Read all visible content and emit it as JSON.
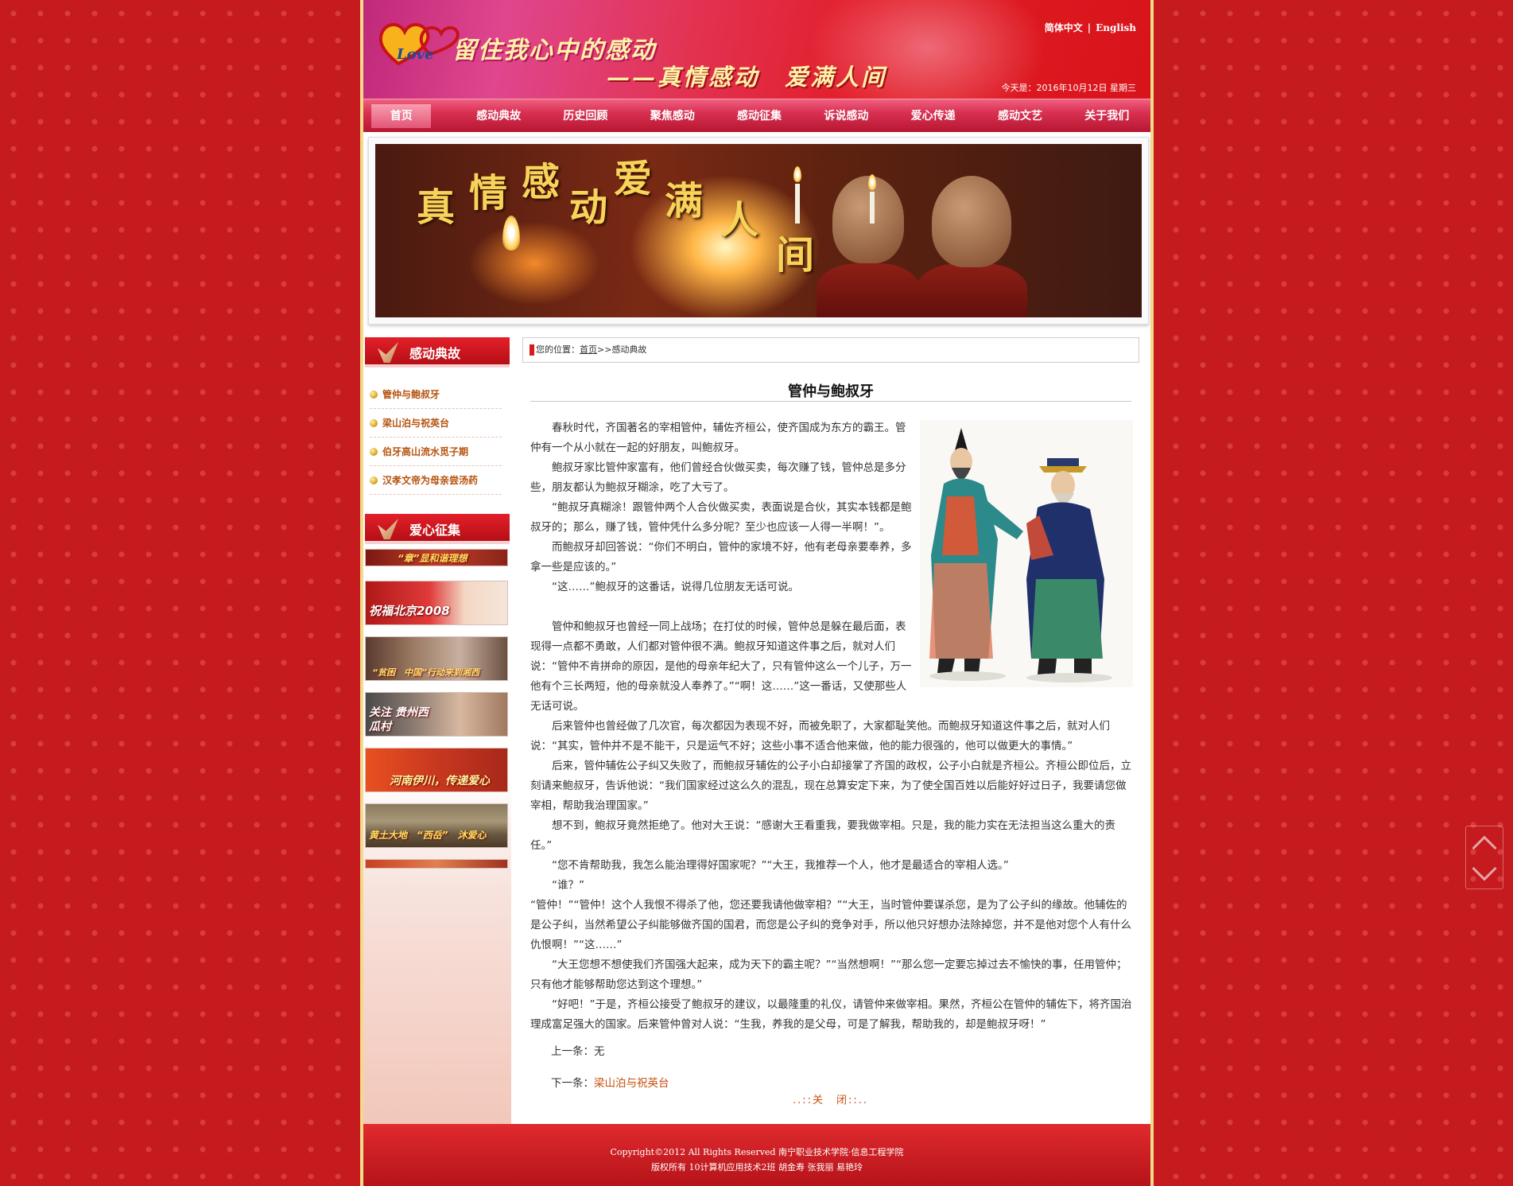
{
  "header": {
    "title": "留住我心中的感动",
    "subtitle": "——真情感动　爱满人间",
    "lang_cn": "简体中文",
    "lang_sep": "|",
    "lang_en": "English",
    "date": "今天是：2016年10月12日 星期三"
  },
  "nav": {
    "items": [
      "首页",
      "感动典故",
      "历史回顾",
      "聚焦感动",
      "感动征集",
      "诉说感动",
      "爱心传递",
      "感动文艺",
      "关于我们"
    ],
    "active": "首页"
  },
  "banner": {
    "chars": [
      "真",
      "情",
      "感",
      "动",
      "爱",
      "满",
      "人",
      "间"
    ]
  },
  "sidebar": {
    "section1_title": "感动典故",
    "items": [
      "管仲与鲍叔牙",
      "梁山泊与祝英台",
      "伯牙高山流水觅子期",
      "汉孝文帝为母亲尝汤药"
    ],
    "section2_title": "爱心征集",
    "thumbs": [
      {
        "label": "“章”显和谐理想"
      },
      {
        "label": "祝福北京2008"
      },
      {
        "label": "“贫困　中国”行动来到湘西"
      },
      {
        "label": "关注 贵州西瓜村"
      },
      {
        "label": "河南伊川，传递爱心"
      },
      {
        "label": "黄土大地　“西岳”　沐爱心"
      },
      {
        "label": ""
      }
    ]
  },
  "breadcrumb": {
    "prefix": "您的位置：",
    "home": "首页",
    "sep": ">>",
    "current": "感动典故"
  },
  "article": {
    "title": "管仲与鲍叔牙",
    "paragraphs": [
      "春秋时代，齐国著名的宰相管仲，辅佐齐桓公，使齐国成为东方的霸王。管仲有一个从小就在一起的好朋友，叫鲍叔牙。",
      "鲍叔牙家比管仲家富有，他们曾经合伙做买卖，每次赚了钱，管仲总是多分些，朋友都认为鲍叔牙糊涂，吃了大亏了。",
      "“鲍叔牙真糊涂！跟管仲两个人合伙做买卖，表面说是合伙，其实本钱都是鲍叔牙的；那么，赚了钱，管仲凭什么多分呢？至少也应该一人得一半啊！”。",
      "而鲍叔牙却回答说：“你们不明白，管仲的家境不好，他有老母亲要奉养，多拿一些是应该的。”",
      "“这……”鲍叔牙的这番话，说得几位朋友无话可说。",
      "管仲和鲍叔牙也曾经一同上战场；在打仗的时候，管仲总是躲在最后面，表现得一点都不勇敢，人们都对管仲很不满。鲍叔牙知道这件事之后，就对人们说：“管仲不肯拼命的原因，是他的母亲年纪大了，只有管仲这么一个儿子，万一他有个三长两短，他的母亲就没人奉养了。”“啊！这……”这一番话，又使那些人无话可说。",
      "后来管仲也曾经做了几次官，每次都因为表现不好，而被免职了，大家都耻笑他。而鲍叔牙知道这件事之后，就对人们说：“其实，管仲并不是不能干，只是运气不好；这些小事不适合他来做，他的能力很强的，他可以做更大的事情。”",
      "后来，管仲辅佐公子纠又失败了，而鲍叔牙辅佐的公子小白却接掌了齐国的政权，公子小白就是齐桓公。齐桓公即位后，立刻请来鲍叔牙，告诉他说：“我们国家经过这么久的混乱，现在总算安定下来，为了使全国百姓以后能好好过日子，我要请您做宰相，帮助我治理国家。”",
      "想不到，鲍叔牙竟然拒绝了。他对大王说：“感谢大王看重我，要我做宰相。只是，我的能力实在无法担当这么重大的责任。”",
      "“您不肯帮助我，我怎么能治理得好国家呢？”“大王，我推荐一个人，他才是最适合的宰相人选。”",
      "“谁？”",
      "“管仲！”“管仲！这个人我恨不得杀了他，您还要我请他做宰相？”“大王，当时管仲要谋杀您，是为了公子纠的缘故。他辅佐的是公子纠，当然希望公子纠能够做齐国的国君，而您是公子纠的竞争对手，所以他只好想办法除掉您，并不是他对您个人有什么仇恨啊！”“这……”",
      "“大王您想不想使我们齐国强大起来，成为天下的霸主呢？”“当然想啊！”“那么您一定要忘掉过去不愉快的事，任用管仲；只有他才能够帮助您达到这个理想。”",
      "“好吧！”于是，齐桓公接受了鲍叔牙的建议，以最隆重的礼仪，请管仲来做宰相。果然，齐桓公在管仲的辅佐下，将齐国治理成富足强大的国家。后来管仲曾对人说：“生我，养我的是父母，可是了解我，帮助我的，却是鲍叔牙呀！”"
    ],
    "prev_label": "上一条：",
    "prev_value": "无",
    "next_label": "下一条：",
    "next_value": "梁山泊与祝英台",
    "close_label": "..::关　闭::.."
  },
  "footer": {
    "line1": "Copyright©2012 All Rights Reserved 南宁职业技术学院·信息工程学院",
    "line2": "版权所有 10计算机应用技术2班 胡金寿 张我丽 易艳玲"
  },
  "colors": {
    "brand_red": "#c51a1e",
    "link_orange": "#c2500e",
    "gold": "#f8d35a"
  }
}
